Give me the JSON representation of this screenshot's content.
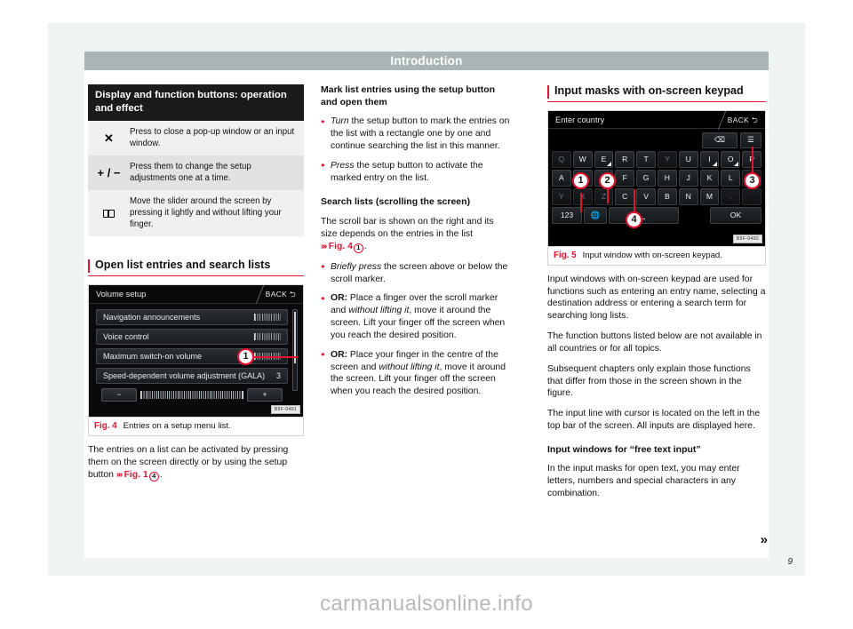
{
  "header": {
    "title": "Introduction"
  },
  "page_number": "9",
  "watermark": "carmanualsonline.info",
  "continuation_marker": "»",
  "table": {
    "heading": "Display and function buttons: operation and effect",
    "rows": [
      {
        "symbol": "✕",
        "symbol_name": "close-x-icon",
        "text": "Press to close a pop-up window or an input window."
      },
      {
        "symbol": "+ / −",
        "symbol_name": "plus-minus-icon",
        "text": "Press them to change the setup adjustments one at a time."
      },
      {
        "symbol": "slider",
        "symbol_name": "slider-icon",
        "text": "Move the slider around the screen by pressing it lightly and without lifting your finger."
      }
    ]
  },
  "section_open_lists": {
    "heading": "Open list entries and search lists",
    "figure": {
      "number": "Fig. 4",
      "caption": "Entries on a setup menu list.",
      "image_code": "B5F-0491",
      "screen": {
        "title": "Volume setup",
        "back_label": "BACK",
        "items": [
          {
            "label": "Navigation announcements",
            "value": ""
          },
          {
            "label": "Voice control",
            "value": ""
          },
          {
            "label": "Maximum switch-on volume",
            "value": ""
          },
          {
            "label": "Speed-dependent volume adjustment (GALA)",
            "value": "3"
          }
        ],
        "minus_label": "−",
        "plus_label": "+",
        "callout": "1"
      }
    },
    "body": {
      "part1": "The entries on a list can be activated by pressing them on the screen directly or by using the setup button ",
      "ref": "Fig. 1",
      "ref_num": "4",
      "part2": "."
    }
  },
  "column_middle": {
    "heading_mark": "Mark list entries using the setup button and open them",
    "bullets": [
      {
        "lead_italic": "Turn",
        "text": " the setup button to mark the entries on the list with a rectangle one by one and continue searching the list in this manner."
      },
      {
        "lead_italic": "Press",
        "text": " the setup button to activate the marked entry on the list."
      }
    ],
    "heading_search": "Search lists (scrolling the screen)",
    "scroll_para": {
      "part1": "The scroll bar is shown on the right and its size depends on the entries in the list ",
      "ref": "Fig. 4",
      "ref_num": "1",
      "part2": "."
    },
    "bullets2": [
      {
        "lead_italic": "Briefly press",
        "text": " the screen above or below the scroll marker."
      },
      {
        "lead_bold": "OR:",
        "text": " Place a finger over the scroll marker and ",
        "italic": "without lifting it",
        "text2": ", move it around the screen. Lift your finger off the screen when you reach the desired position."
      },
      {
        "lead_bold": "OR:",
        "text": " Place your finger in the centre of the screen and ",
        "italic": "without lifting it",
        "text2": ", move it around the screen. Lift your finger off the screen when you reach the desired position."
      }
    ]
  },
  "column_right": {
    "heading": "Input masks with on-screen keypad",
    "figure": {
      "number": "Fig. 5",
      "caption": "Input window with on-screen keypad.",
      "image_code": "B5F-0492",
      "screen": {
        "title": "Enter country",
        "back_label": "BACK",
        "util_keys": [
          "⌫",
          "☰"
        ],
        "row1": [
          "Q",
          "W",
          "E",
          "R",
          "T",
          "Y",
          "U",
          "I",
          "O",
          "P"
        ],
        "row1_dim": [
          true,
          false,
          false,
          false,
          false,
          true,
          false,
          false,
          false,
          false
        ],
        "row2": [
          "A",
          "S",
          "D",
          "F",
          "G",
          "H",
          "J",
          "K",
          "L",
          "Ç"
        ],
        "row2_dim": [
          false,
          false,
          false,
          false,
          false,
          false,
          false,
          false,
          false,
          true
        ],
        "row3": [
          "Y",
          "X",
          "Z",
          "C",
          "V",
          "B",
          "N",
          "M",
          ".",
          ""
        ],
        "row3_dim": [
          true,
          true,
          true,
          false,
          false,
          false,
          false,
          false,
          true,
          true
        ],
        "numeric_label": "123",
        "globe_label": "🌐",
        "space_label": "⎵",
        "ok_label": "OK",
        "callouts": [
          "1",
          "2",
          "3",
          "4"
        ]
      }
    },
    "paragraphs": [
      "Input windows with on-screen keypad are used for functions such as entering an entry name, selecting a destination address or entering a search term for searching long lists.",
      "The function buttons listed below are not available in all countries or for all topics.",
      "Subsequent chapters only explain those functions that differ from those in the screen shown in the figure.",
      "The input line with cursor is located on the left in the top bar of the screen. All inputs are displayed here."
    ],
    "free_text_heading": "Input windows for “free text input”",
    "free_text_para": "In the input masks for open text, you may enter letters, numbers and special characters in any combination."
  },
  "colors": {
    "accent_red": "#e8112d",
    "header_bar": "#a8b5b4",
    "table_head": "#1b1b1b"
  }
}
